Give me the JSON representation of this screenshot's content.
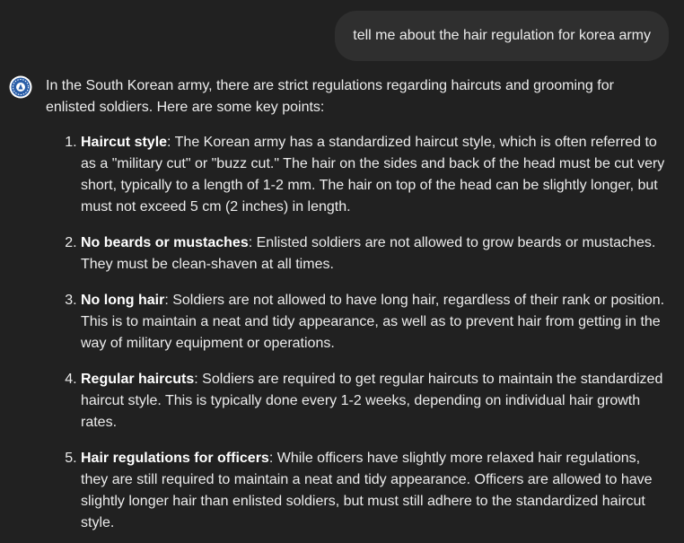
{
  "user_message": "tell me about the hair regulation for korea army",
  "assistant": {
    "avatar_icon": "assistant-logo-icon",
    "intro": "In the South Korean army, there are strict regulations regarding haircuts and grooming for enlisted soldiers. Here are some key points:",
    "points": [
      {
        "term": "Haircut style",
        "text": ": The Korean army has a standardized haircut style, which is often referred to as a \"military cut\" or \"buzz cut.\" The hair on the sides and back of the head must be cut very short, typically to a length of 1-2 mm. The hair on top of the head can be slightly longer, but must not exceed 5 cm (2 inches) in length."
      },
      {
        "term": "No beards or mustaches",
        "text": ": Enlisted soldiers are not allowed to grow beards or mustaches. They must be clean-shaven at all times."
      },
      {
        "term": "No long hair",
        "text": ": Soldiers are not allowed to have long hair, regardless of their rank or position. This is to maintain a neat and tidy appearance, as well as to prevent hair from getting in the way of military equipment or operations."
      },
      {
        "term": "Regular haircuts",
        "text": ": Soldiers are required to get regular haircuts to maintain the standardized haircut style. This is typically done every 1-2 weeks, depending on individual hair growth rates."
      },
      {
        "term": "Hair regulations for officers",
        "text": ": While officers have slightly more relaxed hair regulations, they are still required to maintain a neat and tidy appearance. Officers are allowed to have slightly longer hair than enlisted soldiers, but must still adhere to the standardized haircut style."
      }
    ]
  },
  "colors": {
    "background": "#212121",
    "user_bubble": "#2f2f2f",
    "text": "#ececec",
    "avatar_ring": "#2a5ea8"
  }
}
